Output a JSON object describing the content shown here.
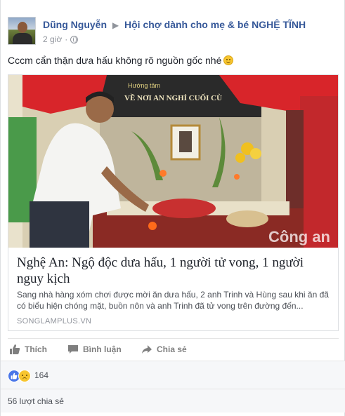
{
  "post": {
    "author": "Dũng Nguyễn",
    "group": "Hội chợ dành cho mẹ & bé NGHỆ TĨNH",
    "time": "2 giờ",
    "message": "Cccm cẩn thận dưa hấu không rõ nguồn gốc nhé"
  },
  "link": {
    "title": "Nghệ An: Ngộ độc dưa hấu, 1 người tử vong, 1 người nguy kịch",
    "description": "Sang nhà hàng xóm chơi được mời ăn dưa hấu, 2 anh Trinh và Hùng sau khi ăn đã có biểu hiện chóng mặt, buồn nôn và anh Trinh đã tử vong trên đường đến...",
    "domain": "SONGLAMPLUS.VN",
    "image_banner_text": "VỀ NƠI AN NGHỈ CUỐI CÙ",
    "image_banner_sub": "Hướng tâm",
    "image_watermark": "Công an"
  },
  "actions": {
    "like": "Thích",
    "comment": "Bình luận",
    "share": "Chia sẻ"
  },
  "reactions": {
    "count": "164",
    "types": [
      "like-icon",
      "sad-icon"
    ],
    "like_color": "#4a76e8",
    "sad_color": "#f7c52f"
  },
  "shares": {
    "label": "56 lượt chia sẻ"
  },
  "colors": {
    "link_blue": "#365899",
    "meta_gray": "#90949c"
  }
}
